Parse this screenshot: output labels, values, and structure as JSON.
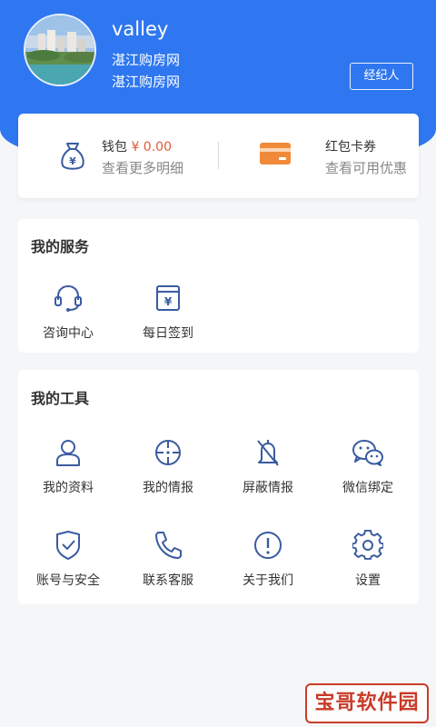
{
  "profile": {
    "username": "valley",
    "subtitle_1": "湛江购房网",
    "subtitle_2": "湛江购房网",
    "agent_button": "经纪人"
  },
  "wallet": {
    "label": "钱包",
    "amount": "¥ 0.00",
    "subtitle": "查看更多明细"
  },
  "coupon": {
    "label": "红包卡券",
    "subtitle": "查看可用优惠"
  },
  "services": {
    "title": "我的服务",
    "items": [
      {
        "label": "咨询中心",
        "icon": "headset-icon"
      },
      {
        "label": "每日签到",
        "icon": "calendar-yuan-icon"
      }
    ]
  },
  "tools": {
    "title": "我的工具",
    "items": [
      {
        "label": "我的资料",
        "icon": "user-icon"
      },
      {
        "label": "我的情报",
        "icon": "crosshair-icon"
      },
      {
        "label": "屏蔽情报",
        "icon": "bell-off-icon"
      },
      {
        "label": "微信绑定",
        "icon": "wechat-icon"
      },
      {
        "label": "账号与安全",
        "icon": "shield-check-icon"
      },
      {
        "label": "联系客服",
        "icon": "phone-icon"
      },
      {
        "label": "关于我们",
        "icon": "info-icon"
      },
      {
        "label": "设置",
        "icon": "gear-icon"
      }
    ]
  },
  "watermark": "宝哥软件园",
  "colors": {
    "primary": "#2f77f0",
    "icon": "#3a5ba0",
    "amount": "#e25a3a",
    "coupon": "#f08a3a"
  }
}
